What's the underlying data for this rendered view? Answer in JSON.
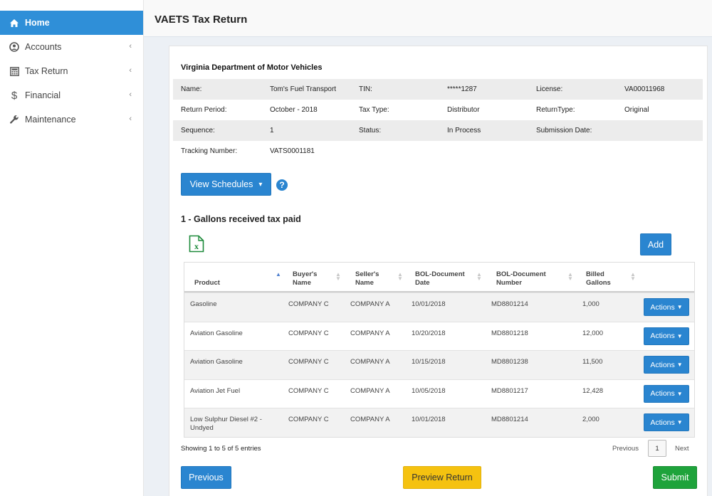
{
  "sidebar": {
    "items": [
      {
        "label": "Home",
        "icon": "home-icon"
      },
      {
        "label": "Accounts",
        "icon": "user-circle-icon"
      },
      {
        "label": "Tax Return",
        "icon": "calculator-icon"
      },
      {
        "label": "Financial",
        "icon": "dollar-icon"
      },
      {
        "label": "Maintenance",
        "icon": "wrench-icon"
      }
    ],
    "chevron": "‹"
  },
  "header": {
    "title": "VAETS Tax Return"
  },
  "return_info": {
    "agency": "Virginia Department of Motor Vehicles",
    "name_label": "Name:",
    "name_value": "Tom's Fuel Transport",
    "tin_label": "TIN:",
    "tin_value": "*****1287",
    "license_label": "License:",
    "license_value": "VA00011968",
    "period_label": "Return Period:",
    "period_value": "October - 2018",
    "taxtype_label": "Tax Type:",
    "taxtype_value": "Distributor",
    "returntype_label": "ReturnType:",
    "returntype_value": "Original",
    "sequence_label": "Sequence:",
    "sequence_value": "1",
    "status_label": "Status:",
    "status_value": "In Process",
    "submission_label": "Submission Date:",
    "submission_value": "",
    "tracking_label": "Tracking Number:",
    "tracking_value": "VATS0001181"
  },
  "view_schedules": {
    "label": "View Schedules",
    "caret": "▾"
  },
  "help": {
    "label": "?"
  },
  "schedule": {
    "title": "1 - Gallons received tax paid",
    "add_label": "Add",
    "columns": {
      "product": "Product",
      "buyer": "Buyer's Name",
      "seller": "Seller's Name",
      "bol_date": "BOL-Document Date",
      "bol_number": "BOL-Document Number",
      "billed": "Billed Gallons"
    },
    "rows": [
      {
        "product": "Gasoline",
        "buyer": "COMPANY C",
        "seller": "COMPANY A",
        "bol_date": "10/01/2018",
        "bol_number": "MD8801214",
        "billed": "1,000",
        "action": "Actions"
      },
      {
        "product": "Aviation Gasoline",
        "buyer": "COMPANY C",
        "seller": "COMPANY A",
        "bol_date": "10/20/2018",
        "bol_number": "MD8801218",
        "billed": "12,000",
        "action": "Actions"
      },
      {
        "product": "Aviation Gasoline",
        "buyer": "COMPANY C",
        "seller": "COMPANY A",
        "bol_date": "10/15/2018",
        "bol_number": "MD8801238",
        "billed": "11,500",
        "action": "Actions"
      },
      {
        "product": "Aviation Jet Fuel",
        "buyer": "COMPANY C",
        "seller": "COMPANY A",
        "bol_date": "10/05/2018",
        "bol_number": "MD8801217",
        "billed": "12,428",
        "action": "Actions"
      },
      {
        "product": "Low Sulphur Diesel #2 - Undyed",
        "buyer": "COMPANY C",
        "seller": "COMPANY A",
        "bol_date": "10/01/2018",
        "bol_number": "MD8801214",
        "billed": "2,000",
        "action": "Actions"
      }
    ],
    "showing": "Showing 1 to 5 of 5 entries",
    "pager": {
      "previous": "Previous",
      "page": "1",
      "next": "Next"
    }
  },
  "footer": {
    "previous_label": "Previous",
    "preview_label": "Preview Return",
    "submit_label": "Submit"
  },
  "colors": {
    "primary": "#2a85d0",
    "warning": "#f5c210",
    "success": "#1ea33b",
    "excel": "#1d8a3a"
  }
}
